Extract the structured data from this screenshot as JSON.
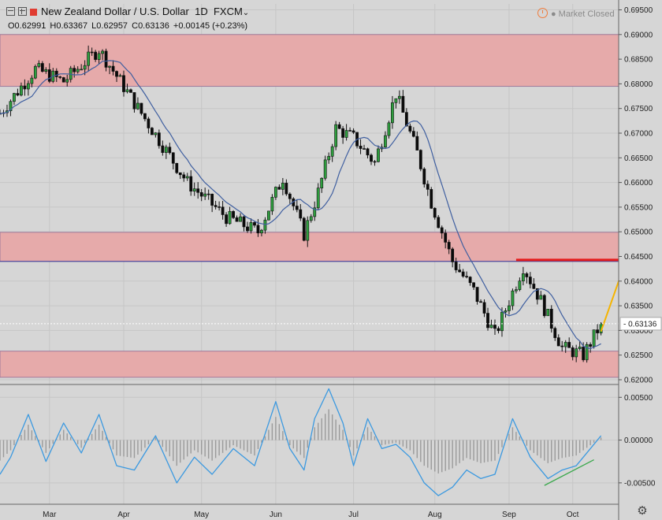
{
  "header": {
    "title": "New Zealand Dollar / U.S. Dollar",
    "interval": "1D",
    "source": "FXCM",
    "open": "O0.62991",
    "high": "H0.63367",
    "low": "L0.62957",
    "close": "C0.63136",
    "change": "+0.00145 (+0.23%)"
  },
  "market_status": "Market Closed",
  "current_price_label": "0.63136",
  "colors": {
    "background": "#d6d6d6",
    "zone_fill": "#e6aaaa",
    "candle_up": "#2e9e3e",
    "candle_down": "#0a0a0a",
    "ma_line": "#3f5fa0",
    "oscillator_line": "#3b99e0",
    "histogram": "#9a9a9a",
    "resistance_line": "#e51c1c",
    "trend_line": "#f5b400",
    "support_trend_line": "#3aa84c"
  },
  "chart_data": [
    {
      "type": "candlestick",
      "title": "New Zealand Dollar / U.S. Dollar",
      "x_tick_labels": [
        "Mar",
        "Apr",
        "May",
        "Jun",
        "Jul",
        "Aug",
        "Sep",
        "Oct"
      ],
      "x_tick_days": [
        14,
        35,
        57,
        78,
        100,
        123,
        144,
        162
      ],
      "x_range_days": [
        0,
        175
      ],
      "y_ticks": [
        "0.69500",
        "0.69000",
        "0.68500",
        "0.68000",
        "0.67500",
        "0.67000",
        "0.66500",
        "0.66000",
        "0.65500",
        "0.65000",
        "0.64500",
        "0.64000",
        "0.63500",
        "0.63000",
        "0.62500",
        "0.62000"
      ],
      "ylim": [
        0.6192,
        0.6962
      ],
      "zones": [
        {
          "low": 0.6795,
          "high": 0.69
        },
        {
          "low": 0.644,
          "high": 0.6499
        },
        {
          "low": 0.6205,
          "high": 0.6258
        }
      ],
      "horizontal_line": 0.644,
      "resistance_segment": {
        "x_days": [
          146,
          175
        ],
        "y": 0.6443
      },
      "trend_segment": {
        "x_days": [
          170,
          176
        ],
        "y": [
          0.6298,
          0.642
        ]
      },
      "price_path_days": [
        0,
        10,
        18,
        28,
        40,
        53,
        64,
        73,
        80,
        86,
        90,
        95,
        100,
        106,
        112,
        118,
        122,
        128,
        134,
        140,
        148,
        153,
        159,
        165,
        170
      ],
      "price_path_values": [
        0.674,
        0.683,
        0.6805,
        0.687,
        0.674,
        0.66,
        0.653,
        0.65,
        0.661,
        0.6495,
        0.658,
        0.671,
        0.669,
        0.664,
        0.678,
        0.666,
        0.656,
        0.644,
        0.638,
        0.629,
        0.643,
        0.636,
        0.6265,
        0.625,
        0.6313
      ],
      "last_price": 0.63136
    },
    {
      "type": "line",
      "name": "oscillator",
      "y_ticks": [
        "0.00500",
        "0.00000",
        "-0.00500"
      ],
      "ylim": [
        -0.0075,
        0.0065
      ],
      "x_days": [
        0,
        3,
        8,
        13,
        18,
        23,
        28,
        33,
        38,
        44,
        50,
        55,
        60,
        66,
        72,
        78,
        82,
        86,
        89,
        93,
        97,
        100,
        104,
        108,
        112,
        116,
        120,
        124,
        128,
        132,
        136,
        140,
        145,
        150,
        155,
        159,
        163,
        167,
        170
      ],
      "values": [
        -0.004,
        -0.002,
        0.003,
        -0.0025,
        0.002,
        -0.0015,
        0.003,
        -0.003,
        -0.0035,
        0.0005,
        -0.005,
        -0.002,
        -0.004,
        -0.001,
        -0.003,
        0.0045,
        -0.001,
        -0.0035,
        0.0025,
        0.006,
        0.002,
        -0.003,
        0.0025,
        -0.001,
        -0.0005,
        -0.002,
        -0.005,
        -0.0065,
        -0.0055,
        -0.0035,
        -0.0045,
        -0.004,
        0.0025,
        -0.002,
        -0.0045,
        -0.0035,
        -0.003,
        -0.001,
        0.0005
      ],
      "support_segment": {
        "x_days": [
          154,
          168
        ],
        "y": [
          -0.0053,
          -0.0023
        ]
      }
    }
  ]
}
